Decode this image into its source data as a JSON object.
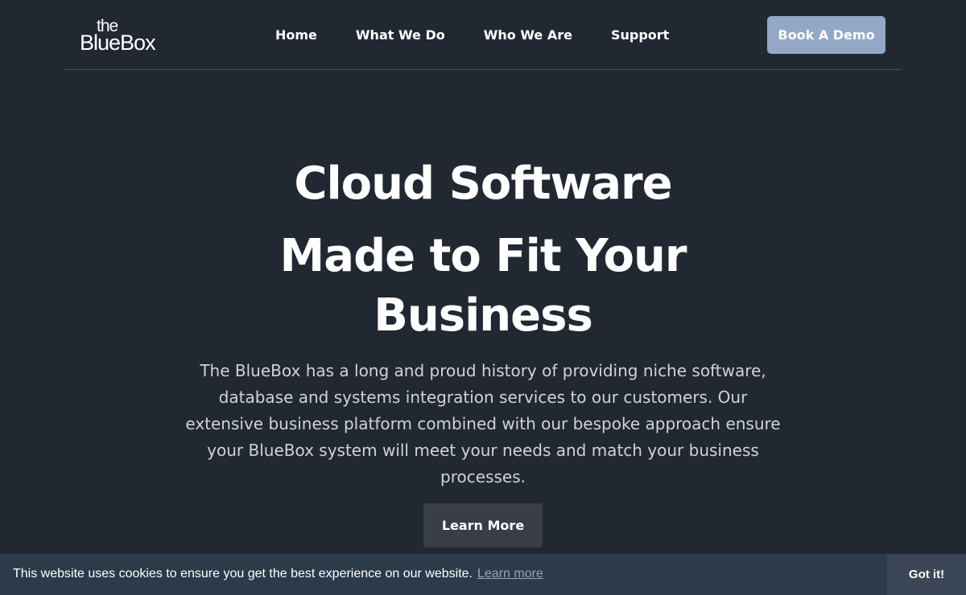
{
  "header": {
    "logo": {
      "the": "the",
      "bluebox": "BlueBox"
    },
    "nav": [
      {
        "label": "Home"
      },
      {
        "label": "What We Do"
      },
      {
        "label": "Who We Are"
      },
      {
        "label": "Support"
      }
    ],
    "demo_button": "Book A Demo"
  },
  "hero": {
    "title_line1": "Cloud Software",
    "title_line2": "Made to Fit Your Business",
    "description": "The BlueBox has a long and proud history of providing niche software, database and systems integration services to our customers. Our extensive business platform combined with our bespoke approach ensure your BlueBox system will meet your needs and match your business processes.",
    "cta": "Learn More"
  },
  "cookie": {
    "message": "This website uses cookies to ensure you get the best experience on our website.",
    "link": "Learn more",
    "button": "Got it!"
  },
  "colors": {
    "background": "#222831",
    "demo_button": "#93a8c6",
    "cta_button": "#393e46",
    "cookie_bar": "#2c3a4a"
  }
}
